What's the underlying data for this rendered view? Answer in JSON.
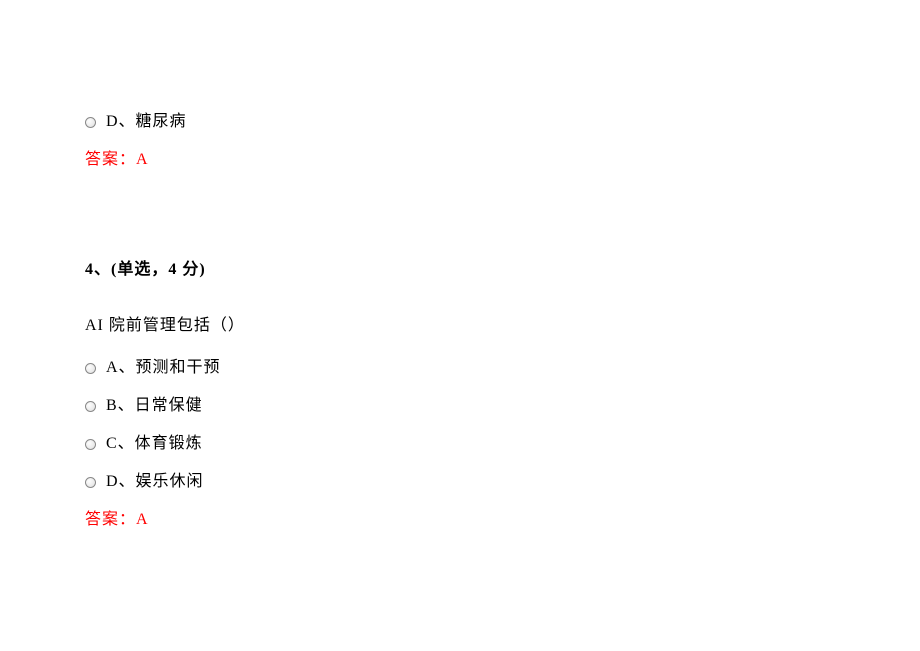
{
  "q3_tail": {
    "optionD": "D、糖尿病",
    "answer_label": "答案：",
    "answer_value": "A"
  },
  "q4": {
    "header": "4、(单选，4 分)",
    "stem": "AI 院前管理包括（）",
    "options": {
      "A": "A、预测和干预",
      "B": "B、日常保健",
      "C": "C、体育锻炼",
      "D": "D、娱乐休闲"
    },
    "answer_label": "答案：",
    "answer_value": "A"
  }
}
